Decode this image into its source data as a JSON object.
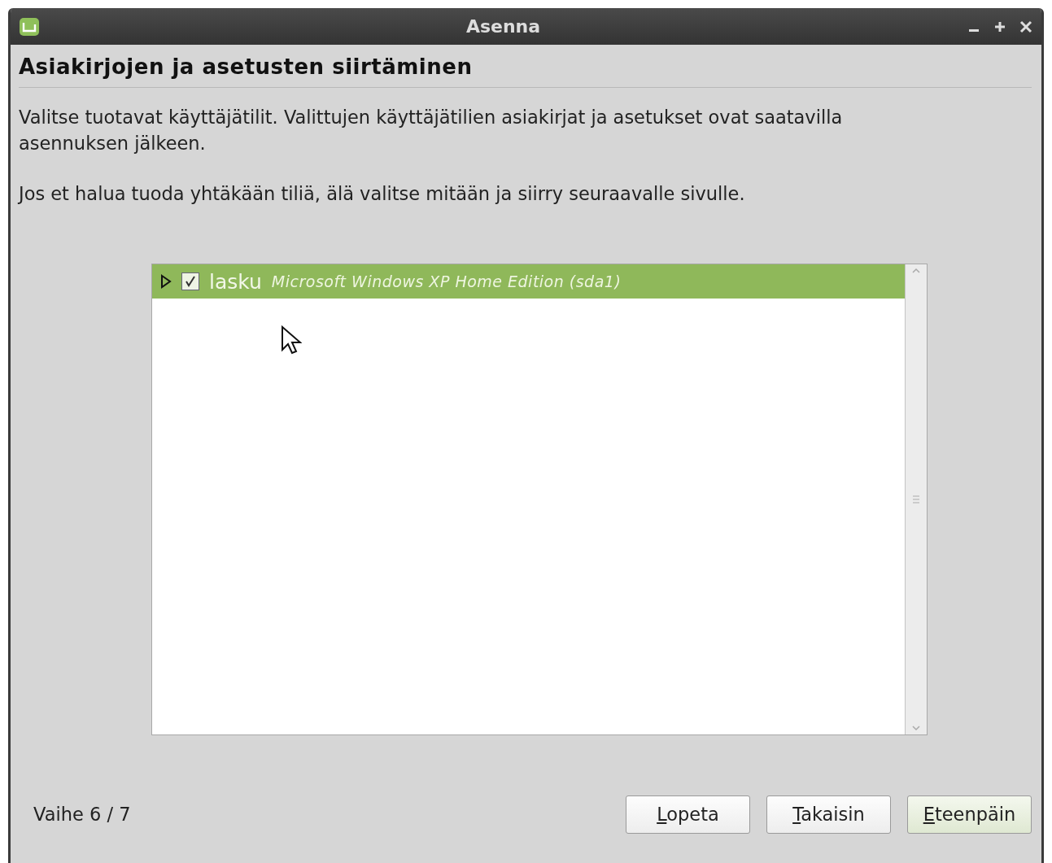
{
  "window": {
    "title": "Asenna"
  },
  "heading": "Asiakirjojen ja asetusten siirtäminen",
  "paragraphs": [
    "Valitse tuotavat käyttäjätilit. Valittujen käyttäjätilien asiakirjat ja asetukset ovat saatavilla asennuksen jälkeen.",
    "Jos et halua tuoda yhtäkään tiliä, älä valitse mitään ja siirry seuraavalle sivulle."
  ],
  "accounts": [
    {
      "name": "lasku",
      "system": "Microsoft Windows XP Home Edition (sda1)",
      "checked": true,
      "expanded": false,
      "selected": true
    }
  ],
  "step": "Vaihe 6 / 7",
  "buttons": [
    {
      "accel": "L",
      "rest": "opeta",
      "default": false
    },
    {
      "accel": "T",
      "rest": "akaisin",
      "default": false
    },
    {
      "accel": "E",
      "rest": "teenpäin",
      "default": true
    }
  ]
}
